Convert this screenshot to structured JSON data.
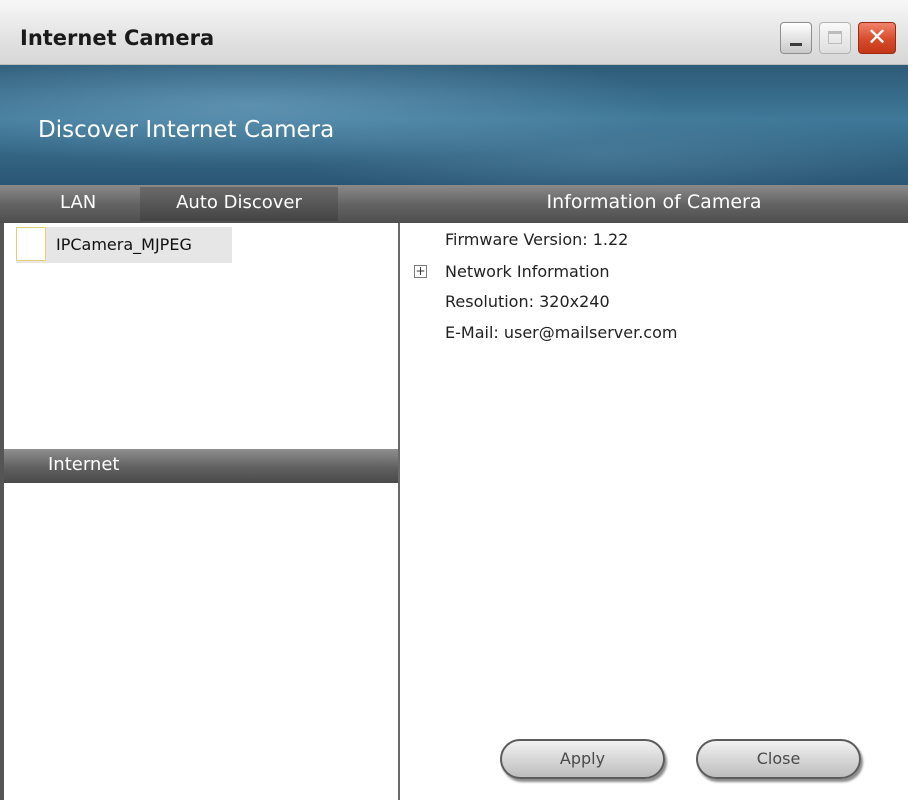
{
  "window": {
    "title": "Internet Camera",
    "close_glyph": "✕"
  },
  "banner": {
    "title": "Discover Internet Camera"
  },
  "tabs": {
    "lan": "LAN",
    "auto_discover": "Auto Discover"
  },
  "info": {
    "header": "Information of Camera",
    "firmware": "Firmware Version:  1.22",
    "network": "Network Information",
    "expand_glyph": "+",
    "resolution": "Resolution: 320x240",
    "email": "E-Mail: user@mailserver.com"
  },
  "lan_list": {
    "items": [
      {
        "label": "IPCamera_MJPEG"
      }
    ]
  },
  "internet": {
    "label": "Internet"
  },
  "buttons": {
    "apply": "Apply",
    "close": "Close"
  },
  "colors": {
    "banner": "#3f7898",
    "header_bar": "#646464",
    "close_button": "#d84a2c"
  },
  "icons": {
    "minimize": "minimize-icon",
    "maximize": "maximize-icon",
    "close": "close-icon",
    "expand": "expand-icon"
  }
}
